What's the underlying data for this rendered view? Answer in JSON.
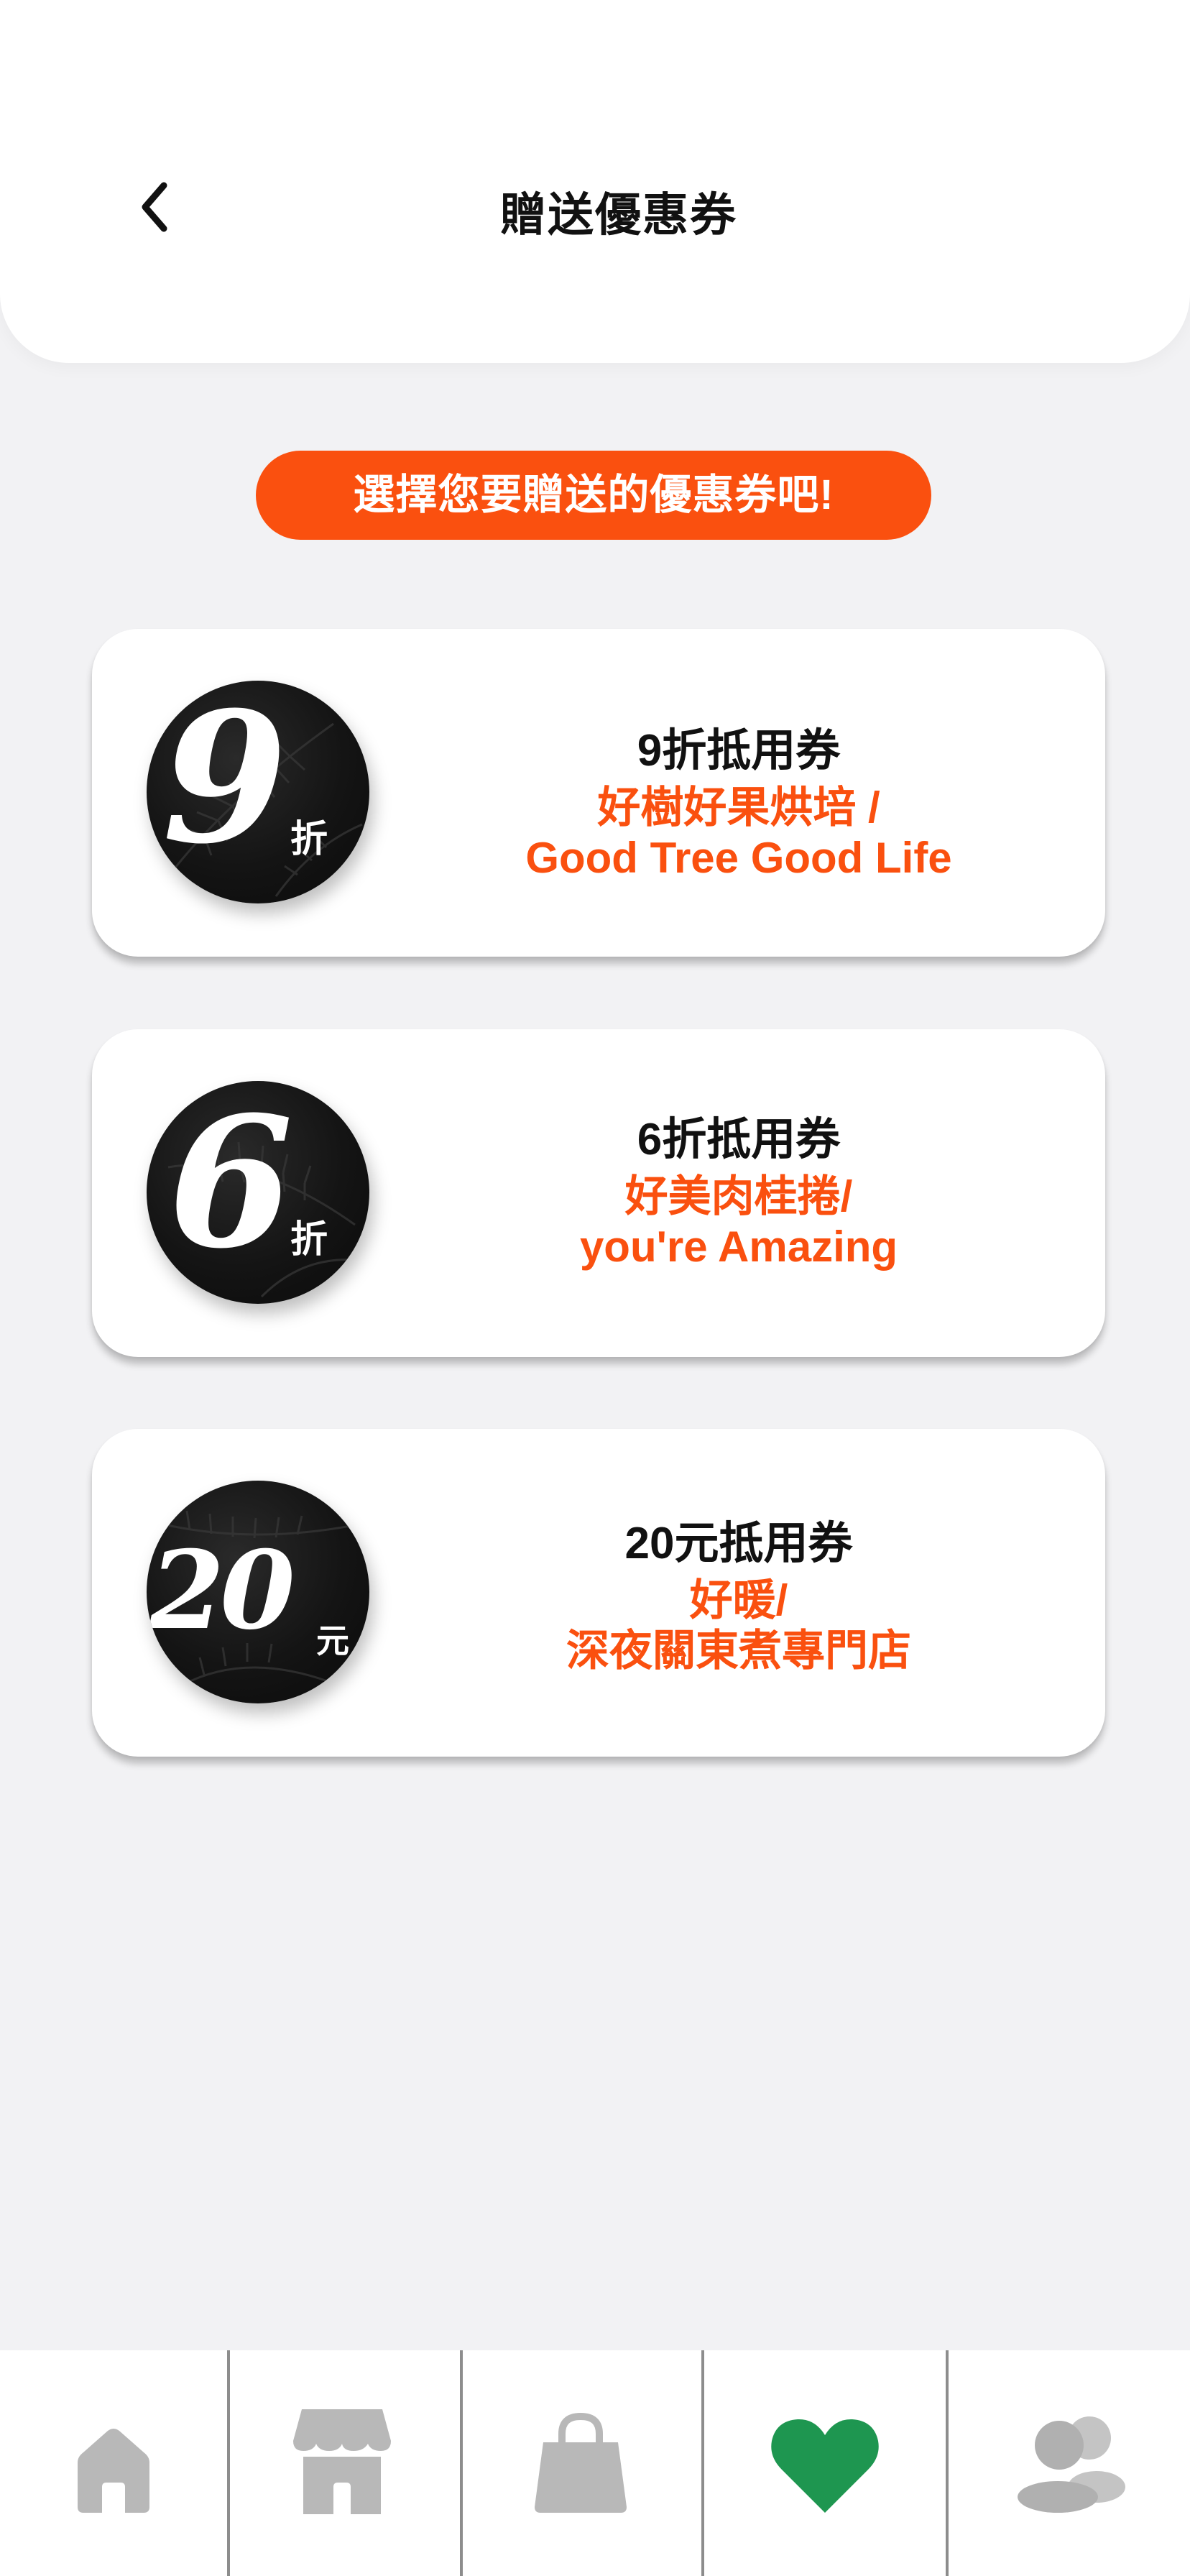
{
  "header": {
    "title": "贈送優惠券",
    "back_icon": "chevron-left-icon"
  },
  "hint": "選擇您要贈送的優惠券吧!",
  "coupons": [
    {
      "badge_number": "9",
      "badge_unit": "折",
      "title": "9折抵用券",
      "store_line1": "好樹好果烘培 /",
      "store_line2": "Good Tree Good Life"
    },
    {
      "badge_number": "6",
      "badge_unit": "折",
      "title": "6折抵用券",
      "store_line1": "好美肉桂捲/",
      "store_line2": "you're Amazing"
    },
    {
      "badge_number": "20",
      "badge_unit": "元",
      "title": "20元抵用券",
      "store_line1": "好暖/",
      "store_line2": "深夜關東煮專門店"
    }
  ],
  "tabbar": {
    "items": [
      {
        "icon": "home-icon",
        "active": false
      },
      {
        "icon": "store-icon",
        "active": false
      },
      {
        "icon": "shopping-bag-icon",
        "active": false
      },
      {
        "icon": "heart-icon",
        "active": true
      },
      {
        "icon": "users-icon",
        "active": false
      }
    ],
    "colors": {
      "active": "#1e9650",
      "inactive": "#b8b8b8"
    }
  },
  "colors": {
    "accent": "#fa500f",
    "background": "#f2f2f4"
  }
}
